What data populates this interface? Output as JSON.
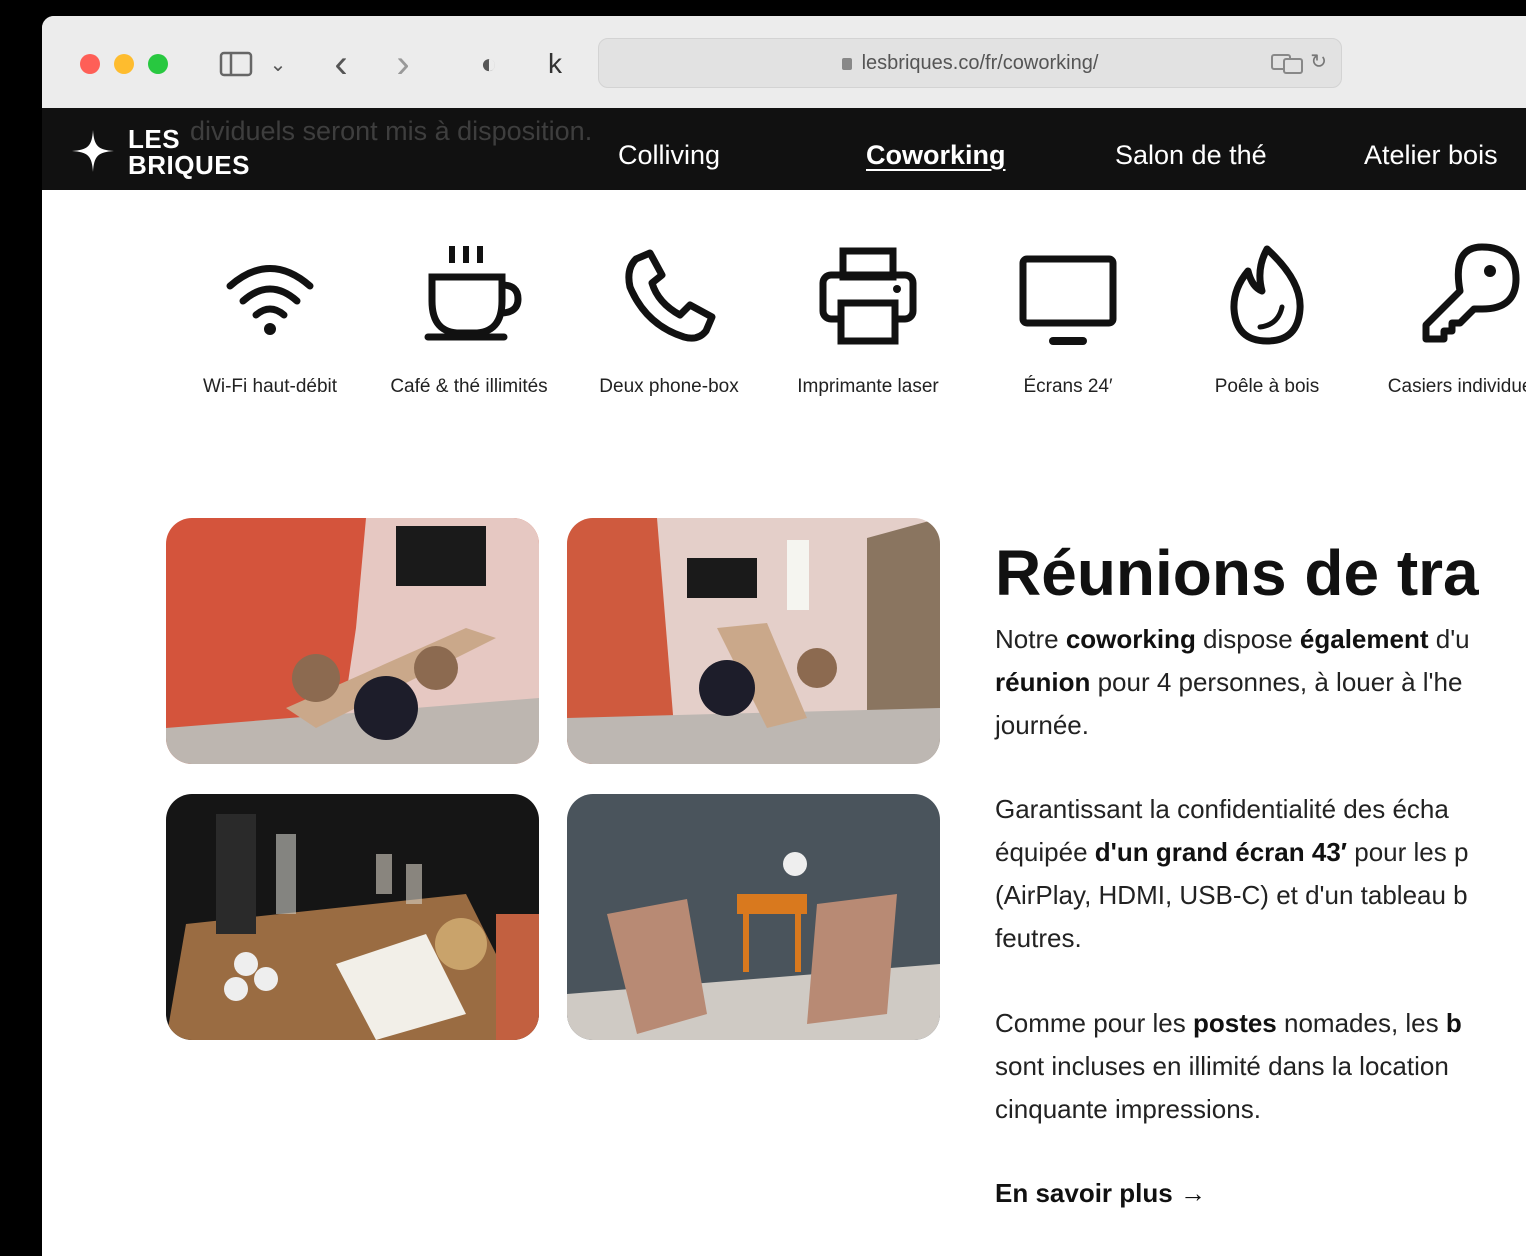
{
  "browser": {
    "url": "lesbriques.co/fr/coworking/",
    "toolbar_glyphs": {
      "back": "‹",
      "forward": "›",
      "shield": "◐",
      "extension": "k",
      "sidebar_chevron": "⌄",
      "reload": "↻"
    }
  },
  "site": {
    "overlay_text": "dividuels seront mis à disposition.",
    "logo": {
      "line1": "LES",
      "line2": "BRIQUES"
    },
    "nav": [
      "Colliving",
      "Coworking",
      "Salon de thé",
      "Atelier bois"
    ],
    "active_nav": "Coworking"
  },
  "amenities": [
    {
      "icon": "wifi-icon",
      "label": "Wi-Fi haut-débit"
    },
    {
      "icon": "coffee-cup-icon",
      "label": "Café & thé illimités"
    },
    {
      "icon": "phone-icon",
      "label": "Deux phone-box"
    },
    {
      "icon": "printer-icon",
      "label": "Imprimante laser"
    },
    {
      "icon": "monitor-icon",
      "label": "Écrans 24′"
    },
    {
      "icon": "flame-icon",
      "label": "Poêle à bois"
    },
    {
      "icon": "key-icon",
      "label": "Casiers individuels"
    }
  ],
  "photos": [
    {
      "alt": "meeting-room-photo-1"
    },
    {
      "alt": "meeting-room-photo-2"
    },
    {
      "alt": "coffee-corner-photo"
    },
    {
      "alt": "phone-box-photo"
    }
  ],
  "section": {
    "heading": "Réunions de tra",
    "p1_parts": [
      "Notre ",
      "coworking",
      " dispose ",
      "également",
      " d'u",
      "réunion",
      " pour 4 personnes, à louer à l'he",
      "journée."
    ],
    "p2_parts": [
      "Garantissant la confidentialité des écha",
      "équipée ",
      "d'un grand écran 43′",
      " pour ",
      "les p",
      "(AirPlay, HDMI, USB-C) et d'un tableau b",
      "feutres."
    ],
    "p3_parts": [
      "Comme pour les ",
      "postes",
      " nomades, les ",
      "b",
      "sont incluses en illimité dans la location",
      "cinquante impressions."
    ],
    "more_link": "En savoir plus →"
  },
  "colors": {
    "traffic_red": "#fe5f57",
    "traffic_yellow": "#febc2e",
    "traffic_green": "#28c840",
    "nav_bg": "#111111",
    "accent_wall": "#c9543a"
  }
}
